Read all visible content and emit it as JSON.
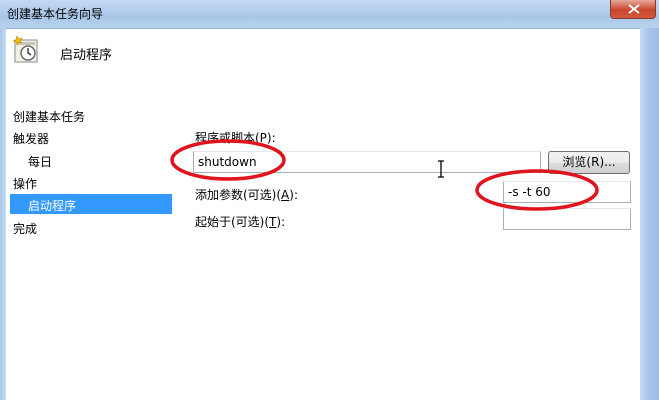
{
  "window": {
    "title": "创建基本任务向导"
  },
  "header": {
    "title": "启动程序"
  },
  "nav": {
    "items": [
      {
        "label": "创建基本任务"
      },
      {
        "label": "触发器"
      },
      {
        "label": "每日"
      },
      {
        "label": "操作"
      },
      {
        "label": "启动程序"
      },
      {
        "label": "完成"
      }
    ],
    "selected": "启动程序"
  },
  "form": {
    "program_label": "程序或脚本(P):",
    "program_value": "shutdown",
    "browse_label": "浏览(R)...",
    "args_label_main": "添加参数(可选)(",
    "args_label_key": "A",
    "args_label_tail": "):",
    "args_value": "-s -t 60",
    "start_label_main": "起始于(可选)(",
    "start_label_key": "T",
    "start_label_tail": "):",
    "start_value": ""
  },
  "colors": {
    "selection": "#3399ff",
    "annotation": "#e0141e"
  }
}
